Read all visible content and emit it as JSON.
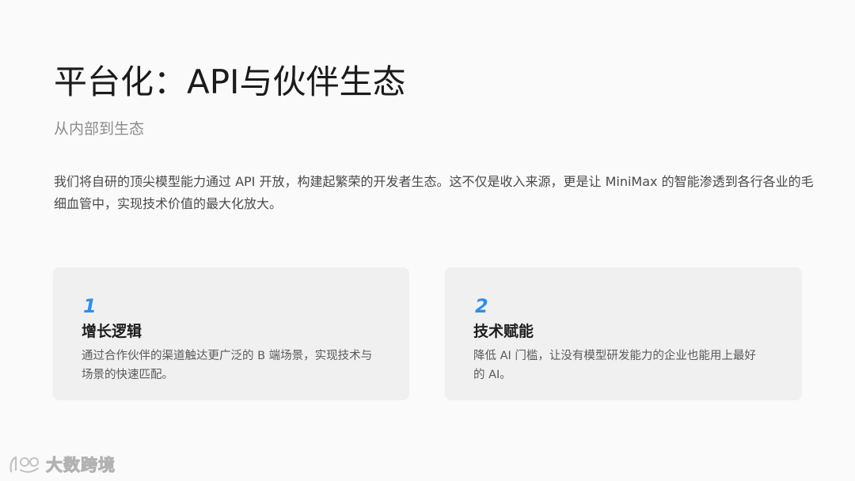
{
  "slide": {
    "title": "平台化：API与伙伴生态",
    "subtitle": "从内部到生态",
    "body": "我们将自研的顶尖模型能力通过 API 开放，构建起繁荣的开发者生态。这不仅是收入来源，更是让 MiniMax 的智能渗透到各行各业的毛细血管中，实现技术价值的最大化放大。"
  },
  "cards": [
    {
      "number": "1",
      "title": "增长逻辑",
      "description": "通过合作伙伴的渠道触达更广泛的 B 端场景，实现技术与场景的快速匹配。"
    },
    {
      "number": "2",
      "title": "技术赋能",
      "description": "降低 AI 门槛，让没有模型研发能力的企业也能用上最好的 AI。"
    }
  ],
  "watermark": {
    "text": "大数跨境"
  },
  "colors": {
    "accent": "#2e8fe6",
    "background": "#fafafa",
    "card": "#f0f0f0"
  }
}
